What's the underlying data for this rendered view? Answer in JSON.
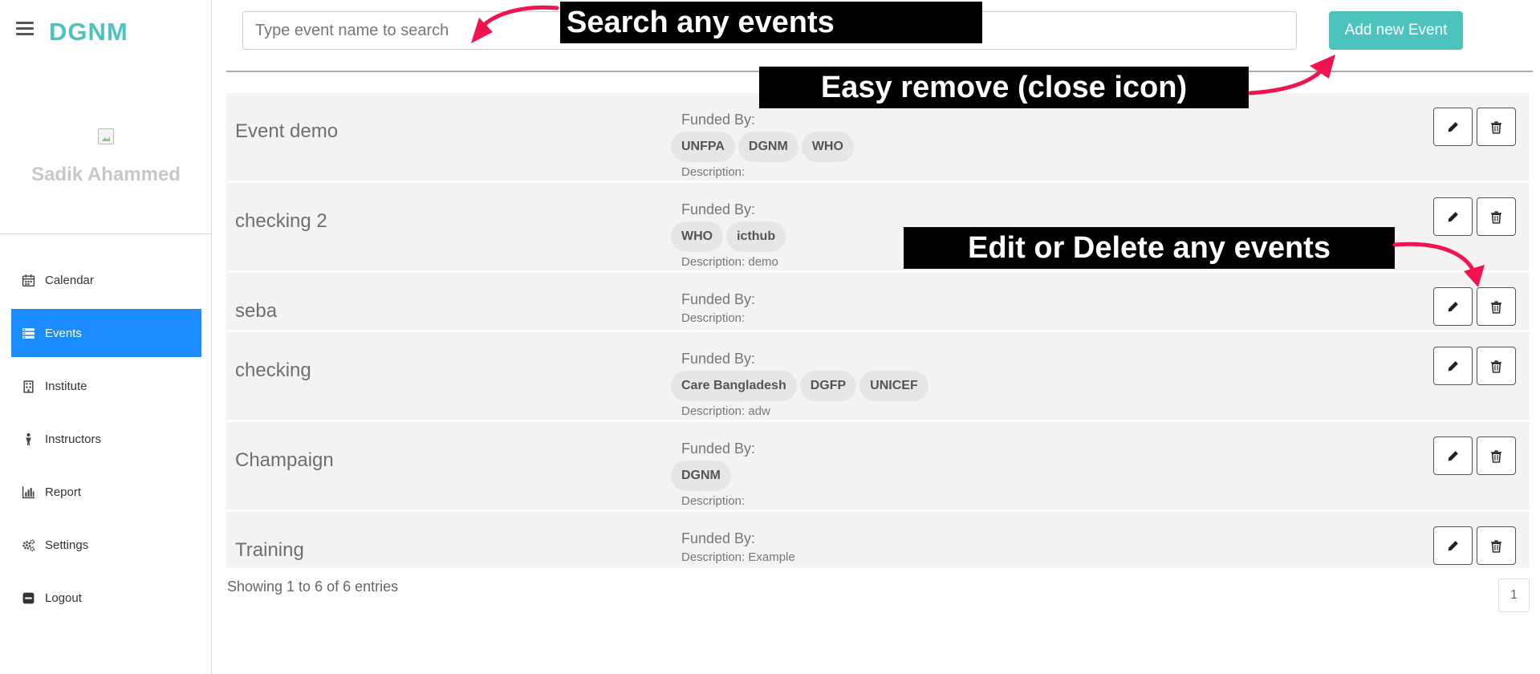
{
  "sidebar": {
    "brand": "DGNM",
    "username": "Sadik Ahammed",
    "items": [
      {
        "label": "Calendar",
        "icon": "calendar-icon"
      },
      {
        "label": "Events",
        "icon": "events-list-icon",
        "active": true
      },
      {
        "label": "Institute",
        "icon": "building-icon"
      },
      {
        "label": "Instructors",
        "icon": "person-icon"
      },
      {
        "label": "Report",
        "icon": "bar-chart-icon"
      },
      {
        "label": "Settings",
        "icon": "gears-icon"
      },
      {
        "label": "Logout",
        "icon": "logout-icon"
      }
    ]
  },
  "search": {
    "placeholder": "Type event name to search",
    "value": ""
  },
  "toolbar": {
    "add_label": "Add new Event"
  },
  "funded_by_label": "Funded By:",
  "events": [
    {
      "title": "Event demo",
      "funders": [
        "UNFPA",
        "DGNM",
        "WHO"
      ],
      "description": "Description:"
    },
    {
      "title": "checking 2",
      "funders": [
        "WHO",
        "icthub"
      ],
      "description": "Description: demo"
    },
    {
      "title": "seba",
      "funders": [],
      "description": "Description:"
    },
    {
      "title": "checking",
      "funders": [
        "Care Bangladesh",
        "DGFP",
        "UNICEF"
      ],
      "description": "Description: adw"
    },
    {
      "title": "Champaign",
      "funders": [
        "DGNM"
      ],
      "description": "Description:"
    },
    {
      "title": "Training",
      "funders": [],
      "description": "Description: Example"
    }
  ],
  "footer": {
    "showing": "Showing 1 to 6 of 6 entries",
    "page": "1"
  },
  "annotations": {
    "search": "Search any events",
    "remove": "Easy remove (close icon)",
    "edit_delete": "Edit or Delete any events"
  },
  "colors": {
    "brand": "#4cc4bd",
    "active_nav": "#1a8cff",
    "arrow": "#f0134d",
    "row_bg": "#f3f3f3"
  }
}
